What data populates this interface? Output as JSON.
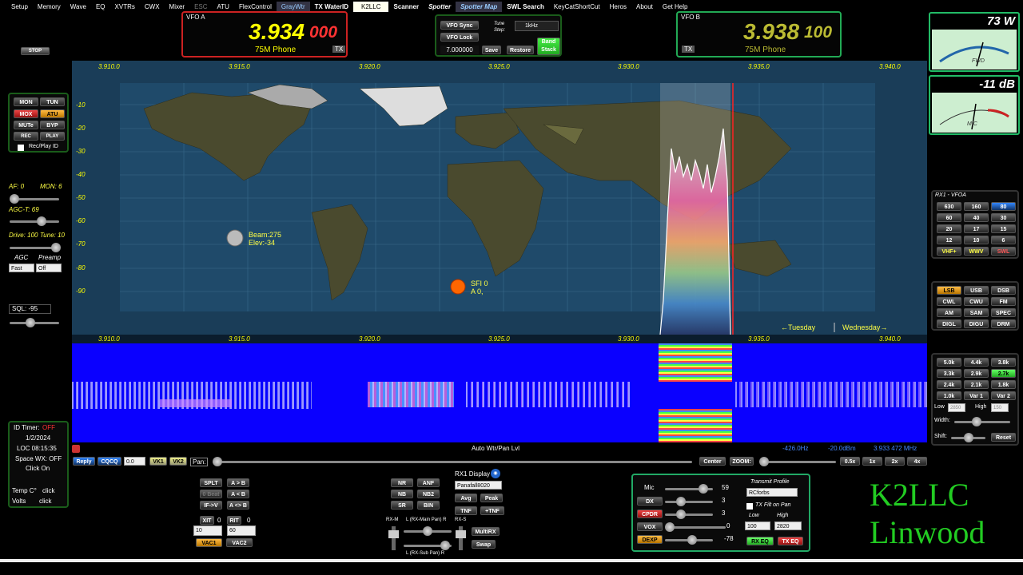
{
  "menu": [
    "Setup",
    "Memory",
    "Wave",
    "EQ",
    "XVTRs",
    "CWX",
    "Mixer",
    "ESC",
    "ATU",
    "FlexControl",
    "GrayWtr",
    "TX WaterID",
    "K2LLC",
    "Scanner",
    "Spotter",
    "Spotter Map",
    "SWL Search",
    "KeyCatShortCut",
    "Heros",
    "About",
    "Get Help"
  ],
  "vfo_a": {
    "label": "VFO A",
    "freq_main": "3.934",
    "freq_sub": "000",
    "mode": "75M Phone",
    "tx": "TX"
  },
  "vfo_b": {
    "label": "VFO B",
    "freq_main": "3.938",
    "freq_sub": "100",
    "mode": "75M Phone",
    "tx": "TX"
  },
  "center_ctrl": {
    "vfo_sync": "VFO Sync",
    "vfo_lock": "VFO Lock",
    "tune_step_label": "Tune Step:",
    "tune_step": "1kHz",
    "freq": "7.000000",
    "save": "Save",
    "restore": "Restore",
    "band_stack": "Band Stack"
  },
  "left": {
    "stop": "STOP",
    "mon": "MON",
    "tun": "TUN",
    "mox": "MOX",
    "atu": "ATU",
    "mute": "MUTe",
    "byp": "BYP",
    "rec": "REC",
    "play": "PLAY",
    "rec_play_id": "Rec/Play ID",
    "af": "AF: 0",
    "mon_v": "MON: 6",
    "agct": "AGC-T: 69",
    "drive": "Drive: 100",
    "tune": "Tune: 10",
    "agc": "AGC",
    "preamp": "Preamp",
    "agc_val": "Fast",
    "preamp_val": "Off",
    "sql": "SQL: -95",
    "id_timer_label": "ID Timer:",
    "id_timer": "OFF",
    "date": "1/2/2024",
    "loc": "LOC 08:15:35",
    "space_wx": "Space WX: OFF",
    "click_on": "Click On",
    "temp": "Temp C°",
    "click1": "click",
    "volts": "Volts",
    "click2": "click"
  },
  "panadapter": {
    "freqs": [
      "3.910.0",
      "3.915.0",
      "3.920.0",
      "3.925.0",
      "3.930.0",
      "3.935.0",
      "3.940.0"
    ],
    "dbm": [
      "-10",
      "-20",
      "-30",
      "-40",
      "-50",
      "-60",
      "-70",
      "-80",
      "-90"
    ],
    "beam": "Beam:275",
    "elev": "Elev:-34",
    "sfi": "SFI 0",
    "a": "A 0,",
    "tuesday": "←Tuesday",
    "wednesday": "Wednesday→"
  },
  "wf_bar": {
    "title": "Auto Wtr/Pan Lvl",
    "hz": "-426.0Hz",
    "dbm": "-20.0dBm",
    "mhz": "3.933 472 MHz"
  },
  "bottom_bar": {
    "reply": "Reply",
    "cqcq": "CQCQ",
    "val": "0.0",
    "vk1": "VK1",
    "vk2": "VK2",
    "pan": "Pan:",
    "center": "Center",
    "zoom": "ZOOM:",
    "z05": "0.5x",
    "z1": "1x",
    "z2": "2x",
    "z4": "4x"
  },
  "split": {
    "splt": "SPLT",
    "atob": "A > B",
    "zbeat": "0 Beat",
    "aleb": "A < B",
    "ifv": "IF->V",
    "aswap": "A <> B",
    "xit": "XIT",
    "xitv": "0",
    "rit": "RIT",
    "ritv": "0",
    "xit_step": "10",
    "rit_step": "60",
    "vac1": "VAC1",
    "vac2": "VAC2"
  },
  "dsp": {
    "nr": "NR",
    "anf": "ANF",
    "nb": "NB",
    "nb2": "NB2",
    "sr": "SR",
    "bin": "BIN",
    "rx1display": "RX1 Display",
    "panafall": "Panafall8020",
    "avg": "Avg",
    "peak": "Peak",
    "tnf": "TNF",
    "ptnf": "+TNF",
    "rxm": "RX-M",
    "rxmain": "L (RX-Main Pan) R",
    "rxs": "RX-S",
    "multirx": "MultiRX",
    "swap": "Swap",
    "rxsub": "L (RX-Sub Pan) R"
  },
  "tx": {
    "mic": "Mic",
    "mic_v": "59",
    "dx": "DX",
    "dx_v": "3",
    "cpdr": "CPDR",
    "cpdr_v": "3",
    "vox": "VOX",
    "vox_v": "0",
    "dexp": "DEXP",
    "dexp_v": "-78",
    "profile_label": "Transmit Profile",
    "profile": "RCforbs",
    "tx_filt": "TX Filt on Pan",
    "low": "Low",
    "high": "High",
    "low_v": "100",
    "high_v": "2820",
    "rxeq": "RX EQ",
    "txeq": "TX EQ"
  },
  "callsign": "K2LLC",
  "city": "Linwood",
  "meters": {
    "power": "73 W",
    "power_label": "FWD",
    "db": "-11 dB",
    "db_label": "MIC"
  },
  "bands": {
    "title": "RX1 - VFOA",
    "items": [
      "630",
      "160",
      "80",
      "60",
      "40",
      "30",
      "20",
      "17",
      "15",
      "12",
      "10",
      "6",
      "VHF+",
      "WWV",
      "SWL"
    ],
    "active": "80"
  },
  "modes": {
    "items": [
      "LSB",
      "USB",
      "DSB",
      "CWL",
      "CWU",
      "FM",
      "AM",
      "SAM",
      "SPEC",
      "DIGL",
      "DIGU",
      "DRM"
    ],
    "active": "LSB"
  },
  "filters": {
    "items": [
      "5.0k",
      "4.4k",
      "3.8k",
      "3.3k",
      "2.9k",
      "2.7k",
      "2.4k",
      "2.1k",
      "1.8k",
      "1.0k",
      "Var 1",
      "Var 2"
    ],
    "active": "2.7k",
    "low": "Low",
    "low_v": "2850",
    "high": "High",
    "high_v": "150",
    "width": "Width:",
    "shift": "Shift:",
    "reset": "Reset"
  }
}
